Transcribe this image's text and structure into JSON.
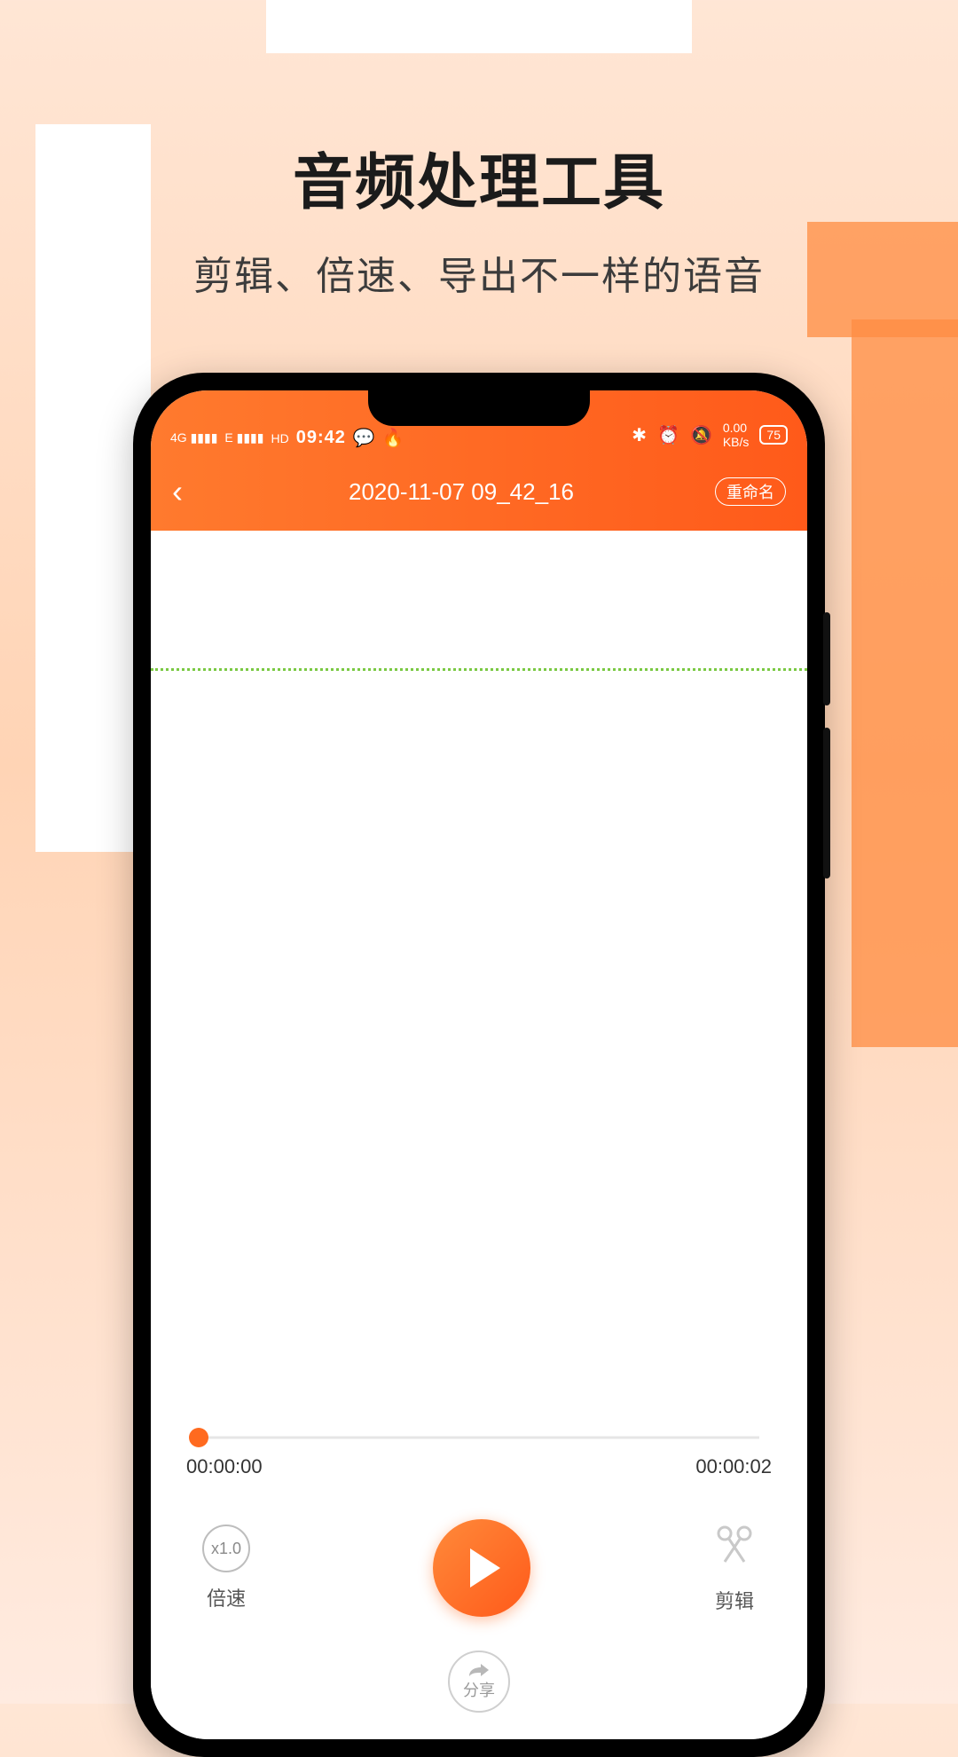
{
  "promo": {
    "title": "音频处理工具",
    "subtitle": "剪辑、倍速、导出不一样的语音"
  },
  "status": {
    "signal1": "4G",
    "signal2": "E",
    "hd": "HD",
    "time": "09:42",
    "net_speed": "0.00",
    "net_unit": "KB/s",
    "battery": "75"
  },
  "header": {
    "title": "2020-11-07 09_42_16",
    "rename_label": "重命名"
  },
  "player": {
    "current_time": "00:00:00",
    "total_time": "00:00:02",
    "speed": "x1.0",
    "speed_label": "倍速",
    "cut_label": "剪辑",
    "share_label": "分享"
  }
}
